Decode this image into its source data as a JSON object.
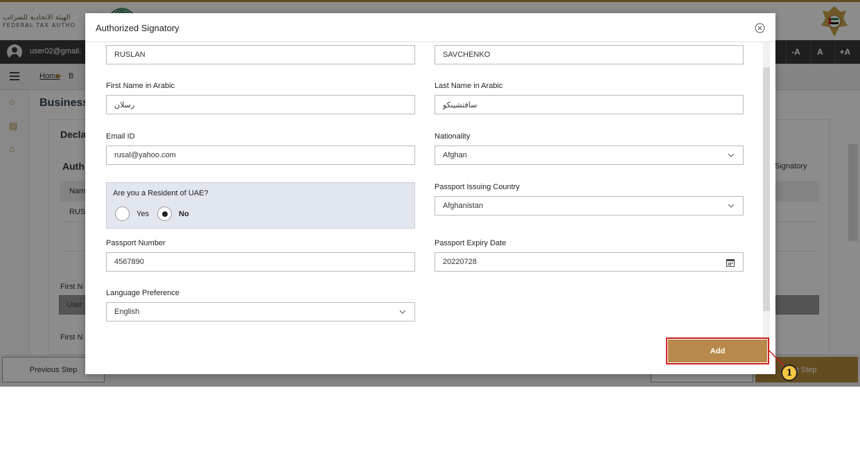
{
  "header": {
    "logo_arabic": "الهيئة الاتحادية للضرائب",
    "logo_english": "FEDERAL TAX AUTHO"
  },
  "userbar": {
    "email": "user02@gmail.",
    "font_decrease": "-A",
    "font_normal": "A",
    "font_increase": "+A"
  },
  "breadcrumb": {
    "home": "Home",
    "next": "B"
  },
  "page": {
    "title": "Business",
    "section": "Decla",
    "subsection": "Auth",
    "table_head_name": "Nam",
    "table_row_name": "RUS",
    "right_header": "Signatory",
    "first_name_label_1": "First N",
    "input_placeholder": "User",
    "first_name_label_2": "First N"
  },
  "footer": {
    "previous": "Previous Step",
    "next": "t Step"
  },
  "modal": {
    "title": "Authorized Signatory",
    "first_name_value": "RUSLAN",
    "last_name_value": "SAVCHENKO",
    "first_name_arabic_label": "First Name in Arabic",
    "first_name_arabic_value": "رسلان",
    "last_name_arabic_label": "Last Name in Arabic",
    "last_name_arabic_value": "سافتشينكو",
    "email_label": "Email ID",
    "email_value": "rusal@yahoo.com",
    "nationality_label": "Nationality",
    "nationality_value": "Afghan",
    "resident_question": "Are you a Resident of UAE?",
    "resident_yes": "Yes",
    "resident_no": "No",
    "resident_selected": "No",
    "passport_country_label": "Passport Issuing Country",
    "passport_country_value": "Afghanistan",
    "passport_number_label": "Passport Number",
    "passport_number_value": "4567890",
    "passport_expiry_label": "Passport Expiry Date",
    "passport_expiry_value": "20220728",
    "language_label": "Language Preference",
    "language_value": "English",
    "add_button": "Add"
  },
  "annotation": {
    "step_number": "1"
  },
  "colors": {
    "accent_gold": "#b8894a",
    "highlight_red": "#cc1f1f",
    "resident_bg": "#e1e6ef"
  }
}
